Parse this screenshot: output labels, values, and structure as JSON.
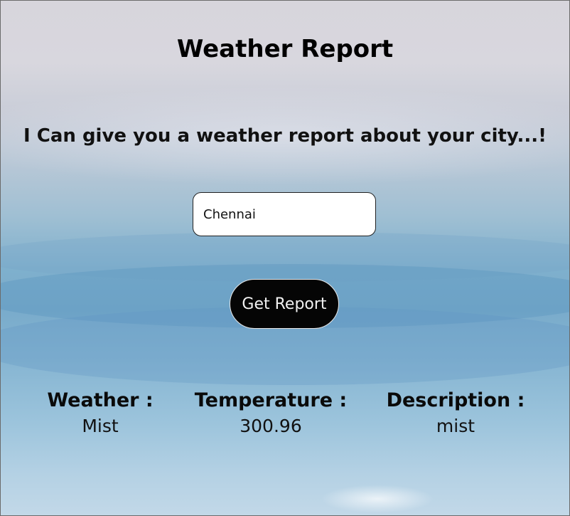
{
  "header": {
    "title": "Weather Report",
    "tagline": "I Can give you a weather report about your city...!"
  },
  "search": {
    "value": "Chennai"
  },
  "button": {
    "label": "Get Report"
  },
  "results": {
    "weather_label": "Weather :",
    "weather_value": "Mist",
    "temperature_label": "Temperature :",
    "temperature_value": "300.96",
    "description_label": "Description :",
    "description_value": "mist"
  },
  "colors": {
    "button_bg": "#050505",
    "button_text": "#f2f2f2",
    "text": "#000000"
  }
}
